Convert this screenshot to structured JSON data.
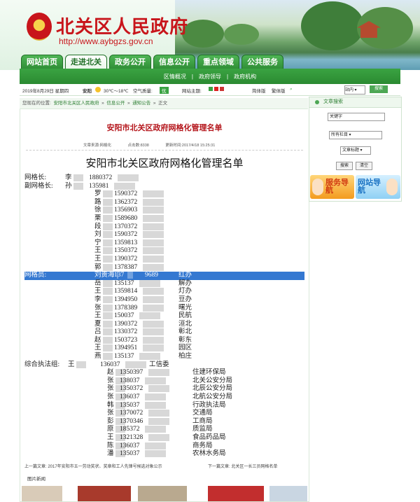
{
  "header": {
    "title": "北关区人民政府",
    "url": "http://www.aybgzs.gov.cn"
  },
  "nav": [
    "网站首页",
    "走进北关",
    "政务公开",
    "信息公开",
    "重点领域",
    "公共服务"
  ],
  "subnav": [
    "区情概况",
    "|",
    "政府领导",
    "|",
    "政府机构"
  ],
  "infobar": {
    "date": "2019年8月29日 星期四",
    "city": "安阳",
    "temp": "30℃～18℃",
    "aqi_label": "空气质量:",
    "aqi": "优",
    "theme_label": "网站主题:",
    "simplified": "简体版",
    "traditional": "繁体版",
    "search_scope": "站内",
    "search_button": "搜索"
  },
  "breadcrumb": {
    "prefix": "您现在的位置:",
    "items": [
      "安阳市北关区人民政府",
      "»",
      "信息公开",
      "»",
      "通知公告",
      "»",
      "正文"
    ]
  },
  "article": {
    "title": "安阳市北关区政府网格化管理名单",
    "source": "文章来源:网格化",
    "views": "点击数:8338",
    "updated": "更新时间:2017/4/18 15:25:31",
    "doc_title": "安阳市北关区政府网格化管理名单"
  },
  "roster": {
    "lines": [
      {
        "label": "网格长:",
        "name": "李",
        "phone": "1880372",
        "unit": ""
      },
      {
        "label": "副网格长:",
        "name": "孙",
        "phone": "135981",
        "unit": ""
      },
      {
        "label": "",
        "name": "罗",
        "phone": "1590372",
        "unit": ""
      },
      {
        "label": "",
        "name": "路",
        "phone": "1362372",
        "unit": ""
      },
      {
        "label": "",
        "name": "徐",
        "phone": "1356903",
        "unit": ""
      },
      {
        "label": "",
        "name": "栗",
        "phone": "1589680",
        "unit": ""
      },
      {
        "label": "",
        "name": "段",
        "phone": "1370372",
        "unit": ""
      },
      {
        "label": "",
        "name": "刘",
        "phone": "1590372",
        "unit": ""
      },
      {
        "label": "",
        "name": "宁",
        "phone": "1359813",
        "unit": ""
      },
      {
        "label": "",
        "name": "王",
        "phone": "1350372",
        "unit": ""
      },
      {
        "label": "",
        "name": "王",
        "phone": "1390372",
        "unit": ""
      },
      {
        "label": "",
        "name": "郭",
        "phone": "1378387",
        "unit": ""
      },
      {
        "label": "网格员:",
        "name": "刘贵海",
        "phone": "137",
        "phone2": "9689",
        "unit": "红办"
      },
      {
        "label": "",
        "name": "岳",
        "phone": "135137",
        "unit": "解办"
      },
      {
        "label": "",
        "name": "王",
        "phone": "1359814",
        "unit": "灯办"
      },
      {
        "label": "",
        "name": "李",
        "phone": "1394950",
        "unit": "豆办"
      },
      {
        "label": "",
        "name": "张",
        "phone": "1378389",
        "unit": "曙光"
      },
      {
        "label": "",
        "name": "王",
        "phone": "150037",
        "unit": "民航"
      },
      {
        "label": "",
        "name": "夏",
        "phone": "1390372",
        "unit": "洹北"
      },
      {
        "label": "",
        "name": "吕",
        "phone": "1330372",
        "unit": "彰北"
      },
      {
        "label": "",
        "name": "赵",
        "phone": "1503723",
        "unit": "彰东"
      },
      {
        "label": "",
        "name": "王",
        "phone": "1394951",
        "unit": "园区"
      },
      {
        "label": "",
        "name": "燕",
        "phone": "135137",
        "unit": "柏庄"
      },
      {
        "label": "综合执法组:",
        "name": "王",
        "phone": "136037",
        "unit": "工信委"
      },
      {
        "label": "",
        "name": "赵",
        "phone": "1350397",
        "unit": "住建环保局"
      },
      {
        "label": "",
        "name": "张",
        "phone": "138037",
        "unit": "北关公安分局"
      },
      {
        "label": "",
        "name": "张",
        "phone": "1350372",
        "unit": "北辰公安分局"
      },
      {
        "label": "",
        "name": "张",
        "phone": "136037",
        "unit": "北航公安分局"
      },
      {
        "label": "",
        "name": "韩",
        "phone": "135037",
        "unit": "行政执法局"
      },
      {
        "label": "",
        "name": "张",
        "phone": "1370072",
        "unit": "交通局"
      },
      {
        "label": "",
        "name": "彭",
        "phone": "1370346",
        "unit": "工商局"
      },
      {
        "label": "",
        "name": "原",
        "phone": "185372",
        "unit": "质监局"
      },
      {
        "label": "",
        "name": "王",
        "phone": "1321328",
        "unit": "食品药品局"
      },
      {
        "label": "",
        "name": "陈",
        "phone": "136037",
        "unit": "商务局"
      },
      {
        "label": "",
        "name": "潘",
        "phone": "135037",
        "unit": "农林水务局"
      }
    ]
  },
  "prevnext": {
    "prev": "上一篇文章: 2017年安阳市五一劳动奖状、奖章和工人先锋号候选对象公示",
    "next": "下一篇文章: 北关区一长三员网格名单"
  },
  "pics_title": "图片新闻",
  "sidebar": {
    "title": "文章搜索",
    "keyword": "关键字",
    "column": "所有栏目",
    "field": "文章标题",
    "search": "搜索",
    "clear": "清空",
    "guide1": "服务导航",
    "guide2": "网站导航"
  },
  "colors": {
    "brand_red": "#c8151b",
    "brand_green": "#2e8d35",
    "highlight": "#3478d1"
  }
}
